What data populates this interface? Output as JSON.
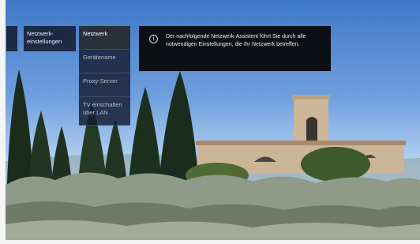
{
  "menu": {
    "breadcrumb_label": "Netzwerk-einstellungen",
    "items": [
      {
        "label": "Netzwerk",
        "selected": true
      },
      {
        "label": "Gerätename",
        "selected": false
      },
      {
        "label": "Proxy-Server",
        "selected": false
      },
      {
        "label": "TV einschalten über LAN",
        "selected": false
      }
    ],
    "info_text": "Der nachfolgende Netzwerk-Assistent führt Sie durch alle notwendigen Einstellungen, die Ihr Netzwerk betreffen.",
    "info_icon": "info-circle-icon"
  },
  "colors": {
    "sky_top": "#3f78c9",
    "panel_bg": "#14182a",
    "selected_bg": "#2a2f38"
  }
}
